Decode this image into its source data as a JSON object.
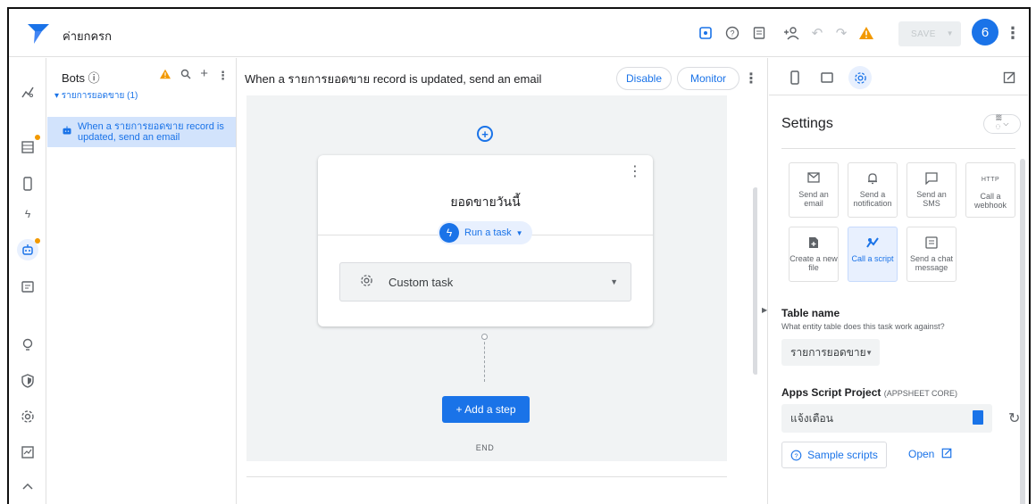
{
  "app": {
    "title": "ค่ายกครก"
  },
  "topbar": {
    "icons": [
      "preview-icon",
      "help-icon",
      "docs-icon",
      "share-icon",
      "undo-icon",
      "redo-icon",
      "warning-icon",
      "more-vert-icon"
    ],
    "save_label": "SAVE",
    "avatar_label": "6",
    "warning_color": "#f29900",
    "accent_color": "#1a73e8"
  },
  "rail": {
    "items": [
      "chart-icon",
      "table-icon",
      "phone-icon",
      "bolt-icon",
      "bot-icon",
      "chat-icon",
      "bulb-icon",
      "security-icon",
      "settings-icon",
      "monitor-icon",
      "chevron-up-icon"
    ]
  },
  "bots": {
    "header": "Bots ⓘ",
    "group_label": "▾ รายการยอดขาย (1)",
    "item_label": "When a รายการยอดขาย record is updated, send an email"
  },
  "canvas": {
    "title": "When a รายการยอดขาย record is updated, send an email",
    "disable_label": "Disable",
    "monitor_label": "Monitor",
    "event_title": "ยอดขายวันนี้",
    "run_task_label": "Run a task",
    "custom_task_label": "Custom task",
    "add_step_label": "+  Add a step",
    "end_label": "END"
  },
  "settings": {
    "title": "Settings",
    "lang_label": "ᢆ",
    "actions": [
      {
        "label": "Send an email",
        "icon": "✉"
      },
      {
        "label": "Send a notification",
        "icon": "🔔"
      },
      {
        "label": "Send an SMS",
        "icon": "💬"
      },
      {
        "label": "Call a webhook",
        "icon": "HTTP"
      },
      {
        "label": "Create a new file",
        "icon": "📄"
      },
      {
        "label": "Call a script",
        "icon": "⚙"
      },
      {
        "label": "Send a chat message",
        "icon": "💭"
      }
    ],
    "table_name_label": "Table name",
    "table_name_help": "What entity table does this task work against?",
    "table_name_value": "รายการยอดขาย",
    "project_label": "Apps Script Project",
    "project_sub": "(APPSHEET CORE)",
    "project_value": "แจ้งเตือน",
    "sample_scripts_label": "Sample scripts",
    "open_label": "Open"
  }
}
